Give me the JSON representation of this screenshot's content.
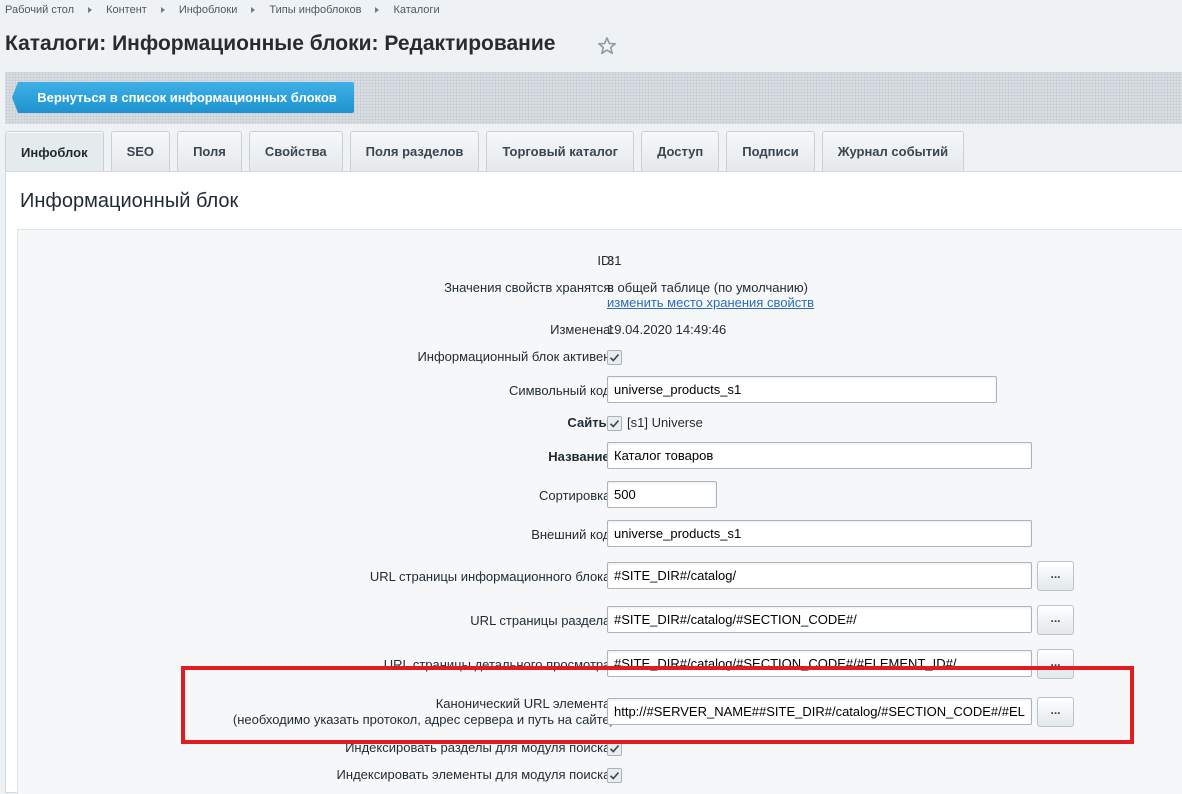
{
  "breadcrumb": [
    "Рабочий стол",
    "Контент",
    "Инфоблоки",
    "Типы инфоблоков",
    "Каталоги"
  ],
  "page_title": "Каталоги: Информационные блоки: Редактирование",
  "toolbar": {
    "back_label": "Вернуться в список информационных блоков"
  },
  "tabs": [
    {
      "label": "Инфоблок",
      "active": true
    },
    {
      "label": "SEO",
      "active": false
    },
    {
      "label": "Поля",
      "active": false
    },
    {
      "label": "Свойства",
      "active": false
    },
    {
      "label": "Поля разделов",
      "active": false
    },
    {
      "label": "Торговый каталог",
      "active": false
    },
    {
      "label": "Доступ",
      "active": false
    },
    {
      "label": "Подписи",
      "active": false
    },
    {
      "label": "Журнал событий",
      "active": false
    }
  ],
  "section_title": "Информационный блок",
  "form": {
    "id_label": "ID:",
    "id_value": "31",
    "storage_label": "Значения свойств хранятся:",
    "storage_value": "в общей таблице (по умолчанию)",
    "storage_link": "изменить место хранения свойств",
    "modified_label": "Изменена:",
    "modified_value": "19.04.2020 14:49:46",
    "active_label": "Информационный блок активен:",
    "active_checked": true,
    "code_label": "Символьный код:",
    "code_value": "universe_products_s1",
    "sites_label": "Сайты:",
    "sites_value": "[s1] Universe",
    "sites_checked": true,
    "name_label": "Название:",
    "name_value": "Каталог товаров",
    "sort_label": "Сортировка:",
    "sort_value": "500",
    "xml_label": "Внешний код:",
    "xml_value": "universe_products_s1",
    "list_url_label": "URL страницы информационного блока:",
    "list_url_value": "#SITE_DIR#/catalog/",
    "section_url_label": "URL страницы раздела:",
    "section_url_value": "#SITE_DIR#/catalog/#SECTION_CODE#/",
    "detail_url_label": "URL страницы детального просмотра:",
    "detail_url_value": "#SITE_DIR#/catalog/#SECTION_CODE#/#ELEMENT_ID#/",
    "canonical_label_1": "Канонический URL элемента:",
    "canonical_label_2": "(необходимо указать протокол, адрес сервера и путь на сайте)",
    "canonical_value": "http://#SERVER_NAME##SITE_DIR#/catalog/#SECTION_CODE#/#ELEMENT_CODE#/",
    "index_sections_label": "Индексировать разделы для модуля поиска:",
    "index_sections_checked": true,
    "index_elements_label": "Индексировать элементы для модуля поиска:",
    "index_elements_checked": true,
    "dots_label": "..."
  },
  "colors": {
    "accent": "#1e93cf",
    "highlight": "#e11b22",
    "link": "#2d6cb8"
  },
  "icons": [
    "chevron-right-icon",
    "star-icon",
    "checkmark-icon"
  ]
}
